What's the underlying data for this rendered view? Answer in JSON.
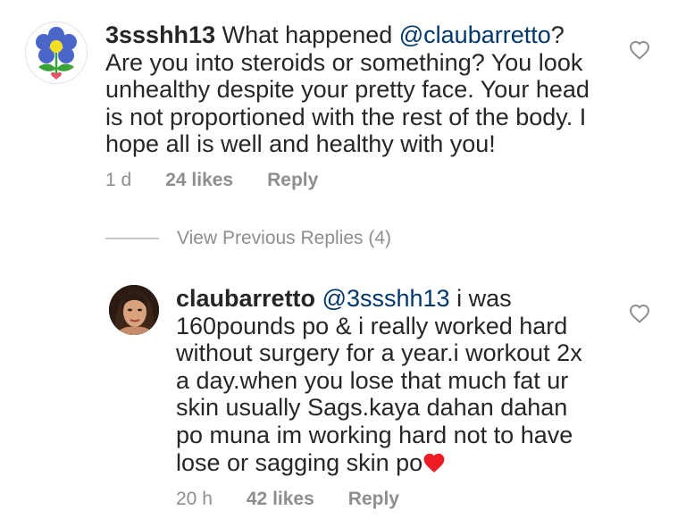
{
  "comment1": {
    "username": "3ssshh13",
    "text_before": " What happened ",
    "mention": "@claubarretto",
    "text_after": "? Are you into steroids or something? You look unhealthy despite your pretty face. Your head is not proportioned with the rest of the body. I hope all is well and healthy with you!",
    "time": "1 d",
    "likes": "24 likes",
    "reply_label": "Reply",
    "avatar_icon": "flower-avatar-icon"
  },
  "view_previous": {
    "label": "View Previous Replies (4)"
  },
  "comment2": {
    "username": "claubarretto",
    "mention": "@3ssshh13",
    "text_after": " i was 160pounds po & i really worked hard without surgery for a year.i workout 2x a day.when you lose that much fat ur skin usually Sags.kaya dahan dahan po muna im working hard not to have lose or sagging skin po",
    "emoji": "red-heart-emoji",
    "time": "20 h",
    "likes": "42 likes",
    "reply_label": "Reply",
    "avatar_icon": "profile-photo-avatar"
  },
  "colors": {
    "text": "#262626",
    "mention": "#00376b",
    "meta": "#8e8e8e",
    "heart": "#ed1c24"
  }
}
